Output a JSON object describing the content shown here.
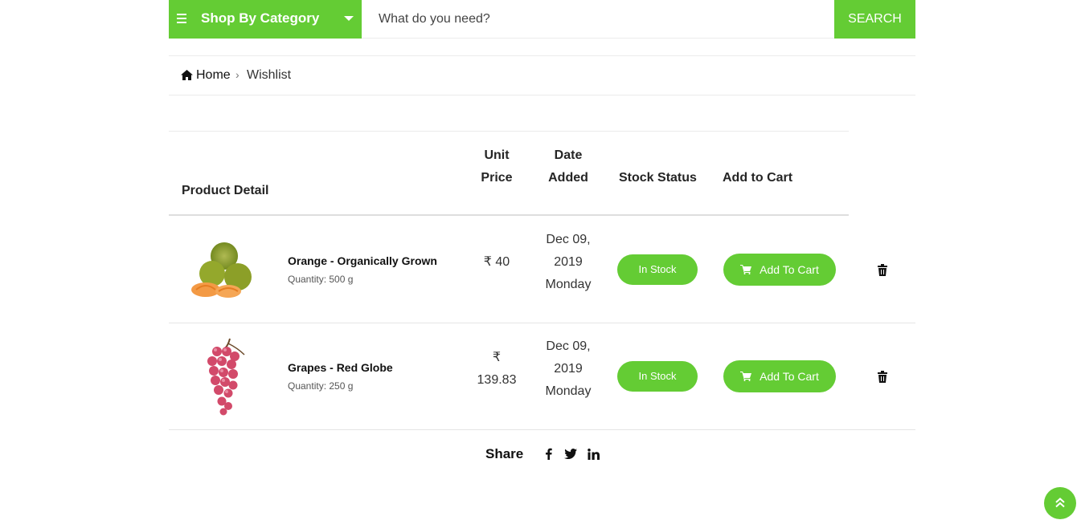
{
  "header": {
    "category_label": "Shop By Category",
    "search_placeholder": "What do you need?",
    "search_button": "SEARCH"
  },
  "breadcrumb": {
    "home": "Home",
    "separator": "›",
    "current": "Wishlist"
  },
  "table": {
    "headers": {
      "product_detail": "Product Detail",
      "unit_price_1": "Unit",
      "unit_price_2": "Price",
      "date_added_1": "Date",
      "date_added_2": "Added",
      "stock_status": "Stock Status",
      "add_to_cart": "Add to Cart"
    },
    "rows": [
      {
        "name": "Orange - Organically Grown",
        "quantity": "Quantity: 500 g",
        "price_line1": "₹ 40",
        "date_line1": "Dec 09,",
        "date_line2": "2019",
        "date_line3": "Monday",
        "stock": "In Stock",
        "cart_label": "Add To Cart",
        "image": "orange-fruit-icon"
      },
      {
        "name": "Grapes - Red Globe",
        "quantity": "Quantity: 250 g",
        "price_line1": "₹",
        "price_line2": "139.83",
        "date_line1": "Dec 09,",
        "date_line2": "2019",
        "date_line3": "Monday",
        "stock": "In Stock",
        "cart_label": "Add To Cart",
        "image": "grapes-fruit-icon"
      }
    ]
  },
  "share": {
    "label": "Share",
    "icons": [
      "facebook-icon",
      "twitter-icon",
      "linkedin-icon"
    ]
  },
  "colors": {
    "accent": "#64cc34",
    "text": "#252525"
  }
}
